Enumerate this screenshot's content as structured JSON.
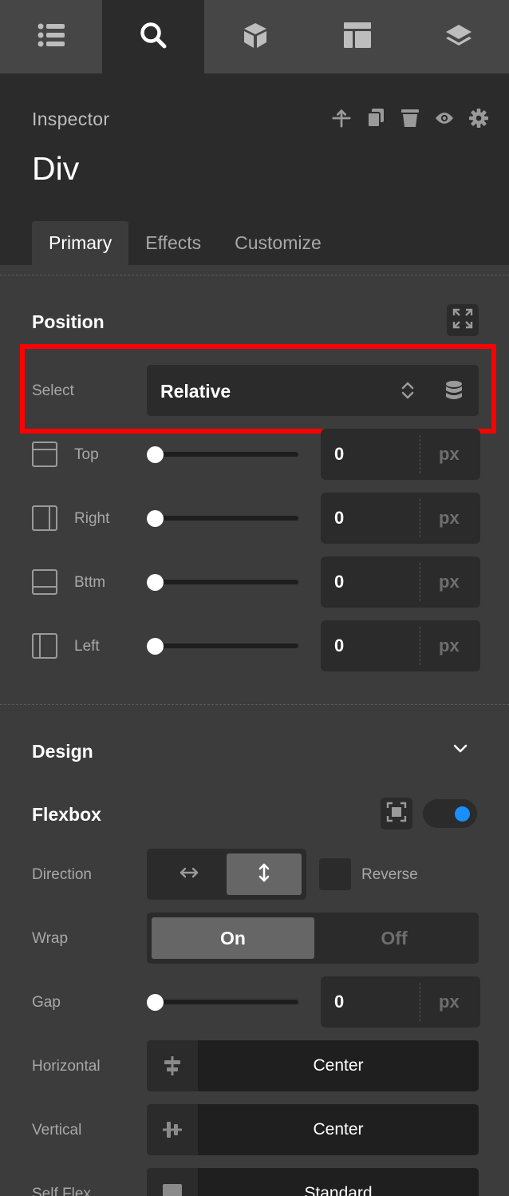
{
  "topbar": {
    "icons": [
      "list-icon",
      "search-icon",
      "cube-icon",
      "layout-icon",
      "layers-icon"
    ],
    "active": "search-icon"
  },
  "header": {
    "panel_label": "Inspector",
    "title": "Div",
    "actions": [
      "move-up-icon",
      "duplicate-icon",
      "delete-icon",
      "visibility-icon",
      "settings-icon"
    ]
  },
  "tabs": [
    {
      "label": "Primary",
      "active": true
    },
    {
      "label": "Effects",
      "active": false
    },
    {
      "label": "Customize",
      "active": false
    }
  ],
  "position": {
    "title": "Position",
    "select_label": "Select",
    "select_value": "Relative",
    "sides": [
      {
        "label": "Top",
        "value": "0",
        "unit": "px"
      },
      {
        "label": "Right",
        "value": "0",
        "unit": "px"
      },
      {
        "label": "Bttm",
        "value": "0",
        "unit": "px"
      },
      {
        "label": "Left",
        "value": "0",
        "unit": "px"
      }
    ]
  },
  "design": {
    "title": "Design",
    "flexbox_title": "Flexbox",
    "flexbox_enabled": true,
    "direction_label": "Direction",
    "direction_selected": "vertical",
    "reverse_label": "Reverse",
    "wrap_label": "Wrap",
    "wrap_on": "On",
    "wrap_off": "Off",
    "gap_label": "Gap",
    "gap_value": "0",
    "gap_unit": "px",
    "horizontal_label": "Horizontal",
    "horizontal_value": "Center",
    "vertical_label": "Vertical",
    "vertical_value": "Center",
    "selfflex_label": "Self Flex",
    "selfflex_value": "Standard"
  },
  "colors": {
    "accent": "#1a8fff",
    "highlight": "#ff0000"
  }
}
